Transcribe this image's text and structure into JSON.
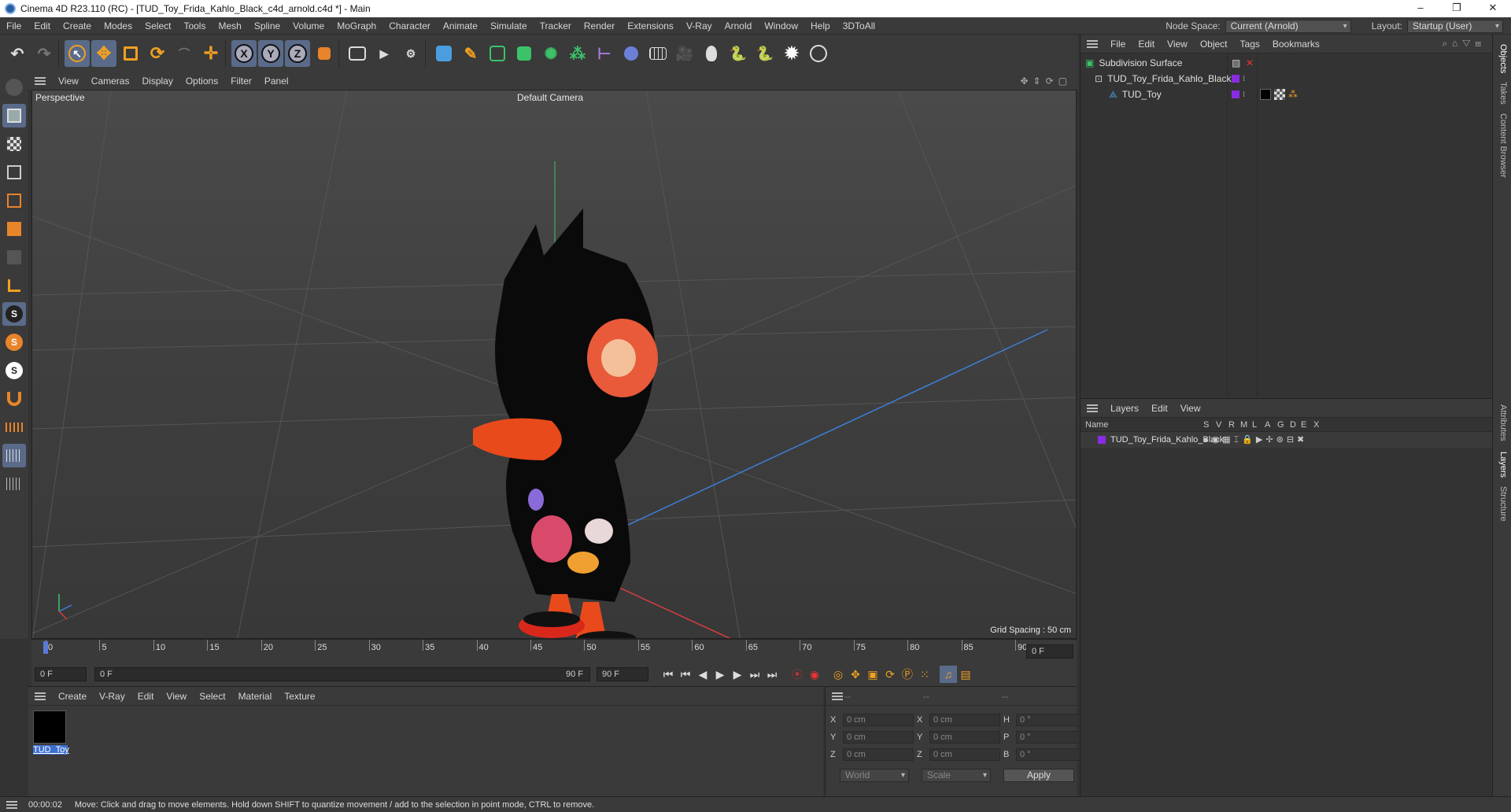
{
  "titlebar": {
    "title": "Cinema 4D R23.110 (RC) - [TUD_Toy_Frida_Kahlo_Black_c4d_arnold.c4d *] - Main",
    "minimize": "–",
    "maximize": "❐",
    "close": "✕"
  },
  "menubar": {
    "items": [
      "File",
      "Edit",
      "Create",
      "Modes",
      "Select",
      "Tools",
      "Mesh",
      "Spline",
      "Volume",
      "MoGraph",
      "Character",
      "Animate",
      "Simulate",
      "Tracker",
      "Render",
      "Extensions",
      "V-Ray",
      "Arnold",
      "Window",
      "Help",
      "3DToAll"
    ],
    "node_space_label": "Node Space:",
    "node_space_value": "Current (Arnold)",
    "layout_label": "Layout:",
    "layout_value": "Startup (User)"
  },
  "toolbar": {
    "axis_x": "X",
    "axis_y": "Y",
    "axis_z": "Z"
  },
  "viewport": {
    "menu": [
      "View",
      "Cameras",
      "Display",
      "Options",
      "Filter",
      "Panel"
    ],
    "view_name": "Perspective",
    "camera": "Default Camera",
    "grid_spacing": "Grid Spacing : 50 cm"
  },
  "timeline": {
    "ticks": [
      "0",
      "5",
      "10",
      "15",
      "20",
      "25",
      "30",
      "35",
      "40",
      "45",
      "50",
      "55",
      "60",
      "65",
      "70",
      "75",
      "80",
      "85",
      "90"
    ],
    "current_frame": "0 F"
  },
  "transport": {
    "start": "0 F",
    "range_start": "0 F",
    "range_end": "90 F",
    "end": "90 F"
  },
  "materials": {
    "menu": [
      "Create",
      "V-Ray",
      "Edit",
      "View",
      "Select",
      "Material",
      "Texture"
    ],
    "items": [
      {
        "name": "TUD_Toy",
        "color": "#000000"
      }
    ]
  },
  "coords": {
    "header": [
      "--",
      "--",
      "--"
    ],
    "rows": [
      {
        "a": "X",
        "v1": "0 cm",
        "b": "X",
        "v2": "0 cm",
        "c": "H",
        "v3": "0 °"
      },
      {
        "a": "Y",
        "v1": "0 cm",
        "b": "Y",
        "v2": "0 cm",
        "c": "P",
        "v3": "0 °"
      },
      {
        "a": "Z",
        "v1": "0 cm",
        "b": "Z",
        "v2": "0 cm",
        "c": "B",
        "v3": "0 °"
      }
    ],
    "mode1": "World",
    "mode2": "Scale",
    "apply": "Apply"
  },
  "objects": {
    "menu": [
      "File",
      "Edit",
      "View",
      "Object",
      "Tags",
      "Bookmarks"
    ],
    "items": [
      {
        "name": "Subdivision Surface",
        "level": 0
      },
      {
        "name": "TUD_Toy_Frida_Kahlo_Black",
        "level": 1
      },
      {
        "name": "TUD_Toy",
        "level": 2
      }
    ]
  },
  "layers": {
    "menu": [
      "Layers",
      "Edit",
      "View"
    ],
    "columns": [
      "Name",
      "S",
      "V",
      "R",
      "M",
      "L",
      "A",
      "G",
      "D",
      "E",
      "X"
    ],
    "items": [
      {
        "name": "TUD_Toy_Frida_Kahlo_Black",
        "color": "#8a2be2"
      }
    ]
  },
  "sidetabs": [
    "Objects",
    "Takes",
    "Content Browser",
    "Attributes",
    "Layers",
    "Structure"
  ],
  "status": {
    "time": "00:00:02",
    "message": "Move: Click and drag to move elements. Hold down SHIFT to quantize movement / add to the selection in point mode, CTRL to remove."
  },
  "colors": {
    "accent": "#5a6b8a",
    "layer_purple": "#8a2be2",
    "duck_beak": "#e84a1c"
  }
}
